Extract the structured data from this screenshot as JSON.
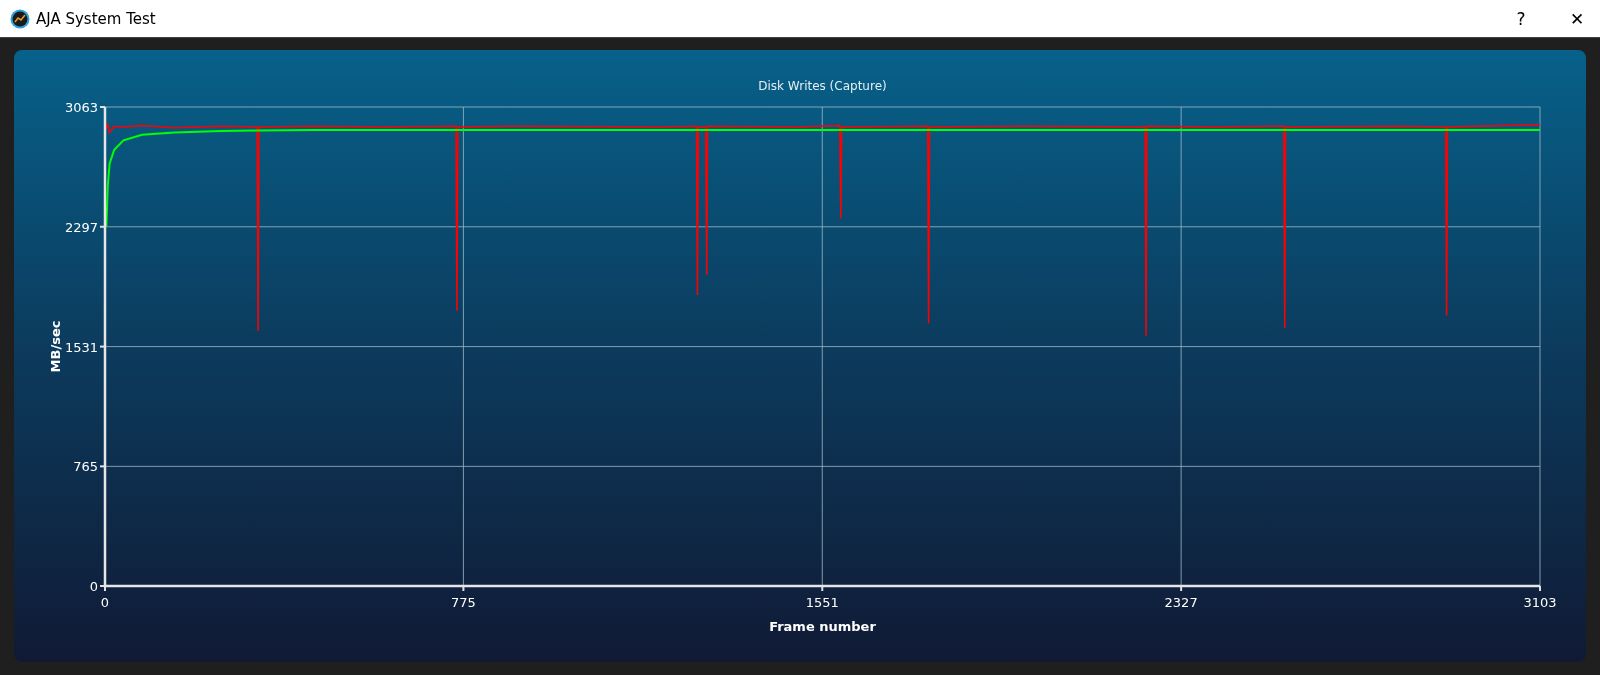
{
  "window": {
    "title": "AJA System Test",
    "buttons": [
      "?",
      "✕"
    ]
  },
  "panel": {
    "chart_data": {
      "type": "line",
      "grid": true,
      "title": "Disk Writes (Capture)",
      "xlabel": "Frame number",
      "ylabel": "MB/sec",
      "xlim": [
        0,
        3103
      ],
      "ylim": [
        0,
        3063
      ],
      "xticks": [
        0,
        775,
        1551,
        2327,
        3103
      ],
      "yticks": [
        0,
        765,
        1531,
        2297,
        3063
      ],
      "x": [
        0,
        3,
        6,
        10,
        20,
        40,
        80,
        150,
        250,
        329,
        331,
        333,
        450,
        600,
        759,
        761,
        763,
        900,
        1200,
        1279,
        1281,
        1283,
        1299,
        1301,
        1303,
        1500,
        1589,
        1591,
        1593,
        1779,
        1781,
        1783,
        2000,
        2249,
        2251,
        2253,
        2400,
        2549,
        2551,
        2553,
        2800,
        2899,
        2901,
        2903,
        3103
      ],
      "series": [
        {
          "color": "#ff0000",
          "values": [
            2960,
            2930,
            2950,
            2900,
            2940,
            2935,
            2945,
            2930,
            2940,
            2935,
            1630,
            2935,
            2940,
            2935,
            2940,
            1760,
            2935,
            2940,
            2935,
            2940,
            1860,
            2935,
            2935,
            1990,
            2940,
            2935,
            2945,
            2350,
            2935,
            2940,
            1680,
            2935,
            2940,
            2935,
            1600,
            2940,
            2935,
            2940,
            1650,
            2935,
            2940,
            2935,
            1730,
            2935,
            2950
          ]
        },
        {
          "color": "#00ff00",
          "values": [
            null,
            2300,
            2560,
            2700,
            2790,
            2850,
            2885,
            2900,
            2910,
            2912,
            2912,
            2912,
            2915,
            2915,
            2915,
            2915,
            2915,
            2915,
            2915,
            2915,
            2915,
            2915,
            2915,
            2915,
            2915,
            2915,
            2915,
            2915,
            2915,
            2915,
            2915,
            2915,
            2915,
            2915,
            2915,
            2915,
            2915,
            2915,
            2915,
            2915,
            2915,
            2915,
            2915,
            2915,
            2915
          ]
        }
      ]
    }
  }
}
